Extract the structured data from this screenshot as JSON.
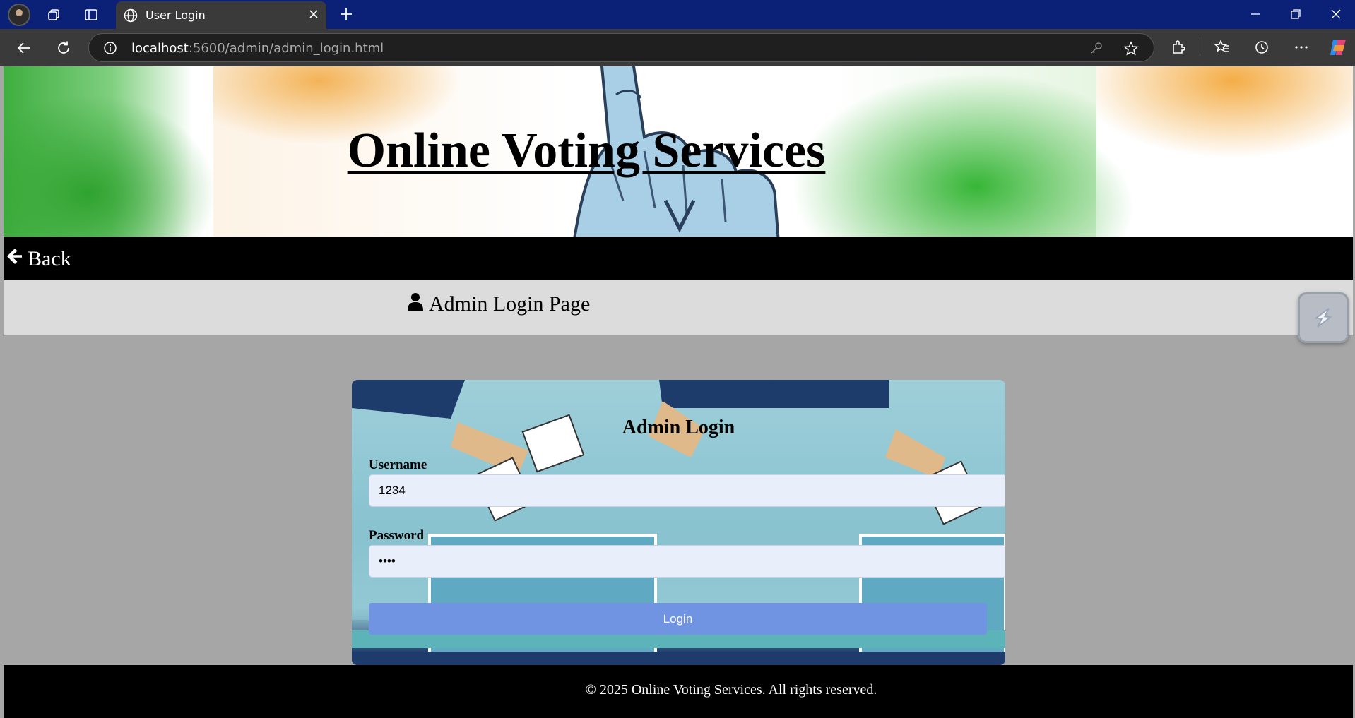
{
  "browser": {
    "tab_title": "User Login",
    "url_host": "localhost",
    "url_path": ":5600/admin/admin_login.html"
  },
  "page": {
    "site_title": "Online Voting Services",
    "back_label": "Back",
    "subheader_title": "Admin Login Page",
    "login_card": {
      "title": "Admin Login",
      "username_label": "Username",
      "username_value": "1234",
      "password_label": "Password",
      "password_value": "••••",
      "login_button": "Login"
    },
    "footer_text": "© 2025 Online Voting Services. All rights reserved."
  }
}
